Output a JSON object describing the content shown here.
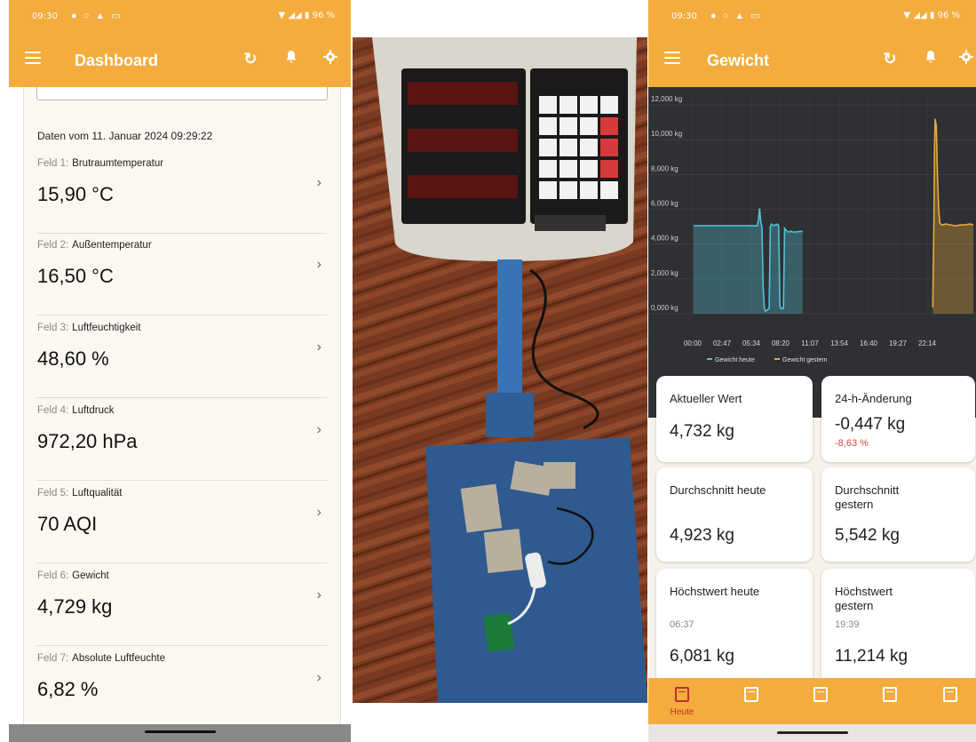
{
  "left_phone": {
    "status": {
      "time": "09:30",
      "battery": "96 %"
    },
    "appbar": {
      "title": "Dashboard"
    },
    "date_line": "Daten vom 11. Januar 2024 09:29:22",
    "fields": [
      {
        "label": "Feld 1:",
        "name": "Brutraumtemperatur",
        "value": "15,90 °C"
      },
      {
        "label": "Feld 2:",
        "name": "Außentemperatur",
        "value": "16,50 °C"
      },
      {
        "label": "Feld 3:",
        "name": "Luftfeuchtigkeit",
        "value": "48,60 %"
      },
      {
        "label": "Feld 4:",
        "name": "Luftdruck",
        "value": "972,20 hPa"
      },
      {
        "label": "Feld 5:",
        "name": "Luftqualität",
        "value": "70 AQI"
      },
      {
        "label": "Feld 6:",
        "name": "Gewicht",
        "value": "4,729 kg"
      },
      {
        "label": "Feld 7:",
        "name": "Absolute Luftfeuchte",
        "value": "6,82 %"
      }
    ]
  },
  "right_phone": {
    "status": {
      "time": "09:30",
      "battery": "96 %"
    },
    "appbar": {
      "title": "Gewicht"
    },
    "tiles": {
      "current": {
        "label": "Aktueller Wert",
        "value": "4,732 kg"
      },
      "change": {
        "label": "24-h-Änderung",
        "value": "-0,447 kg",
        "percent": "-8,63 %"
      },
      "avg_today": {
        "label": "Durchschnitt heute",
        "value": "4,923 kg"
      },
      "avg_yesterday": {
        "label": "Durchschnitt gestern",
        "value": "5,542 kg"
      },
      "max_today": {
        "label": "Höchstwert heute",
        "time": "06:37",
        "value": "6,081 kg"
      },
      "max_yesterday": {
        "label": "Höchstwert gestern",
        "time": "19:39",
        "value": "11,214 kg"
      }
    },
    "bottom_nav": {
      "active_label": "Heute",
      "items": [
        "1",
        "3",
        "7",
        "30",
        "→"
      ]
    }
  },
  "colors": {
    "accent": "#f3ac3d",
    "chart_bg": "#2f3033",
    "today": "#4fc3d9",
    "yesterday": "#e8a93a",
    "negative": "#d9423b"
  },
  "chart_data": {
    "type": "line",
    "y_ticks": [
      "12,000 kg",
      "10,000 kg",
      "8,000 kg",
      "6,000 kg",
      "4,000 kg",
      "2,000 kg",
      "0,000 kg"
    ],
    "ylim": [
      0,
      12
    ],
    "x_ticks": [
      "00:00",
      "02:47",
      "05:34",
      "08:20",
      "11:07",
      "13:54",
      "16:40",
      "19:27",
      "22:14"
    ],
    "xlim": [
      0,
      23.5
    ],
    "series": [
      {
        "name": "Gewicht heute",
        "color": "#4fc3d9",
        "x": [
          0.05,
          5.4,
          5.5,
          5.6,
          5.7,
          5.8,
          5.9,
          6.0,
          6.1,
          6.2,
          6.3,
          6.4,
          6.5,
          6.6,
          6.7,
          6.8,
          6.9,
          7.0,
          7.1,
          7.2,
          7.3,
          7.4,
          7.5,
          7.6,
          7.7,
          7.8,
          7.9,
          8.0,
          8.1,
          8.2,
          8.3,
          8.4,
          8.5,
          8.6,
          8.7,
          8.8,
          9.0,
          9.2
        ],
        "y": [
          5.05,
          5.05,
          5.35,
          6.05,
          5.3,
          4.95,
          1.6,
          0.3,
          0.15,
          0.2,
          0.25,
          0.3,
          5.0,
          5.15,
          5.1,
          5.05,
          5.1,
          5.1,
          5.15,
          5.05,
          0.45,
          0.3,
          0.3,
          0.3,
          4.9,
          4.8,
          4.75,
          4.7,
          4.7,
          4.75,
          4.7,
          4.7,
          4.7,
          4.7,
          4.7,
          4.72,
          4.73,
          4.73
        ]
      },
      {
        "name": "Gewicht gestern",
        "color": "#e8a93a",
        "x": [
          20.1,
          20.2,
          20.25,
          20.3,
          20.4,
          20.5,
          20.6,
          20.7,
          20.9,
          21.2,
          21.6,
          22.0,
          22.4,
          22.8,
          23.2,
          23.5
        ],
        "y": [
          0.35,
          5.2,
          9.5,
          11.2,
          10.8,
          7.8,
          6.0,
          5.2,
          5.1,
          5.15,
          5.1,
          5.05,
          5.1,
          5.1,
          5.15,
          5.1
        ]
      }
    ],
    "legend": "bottom-left"
  }
}
